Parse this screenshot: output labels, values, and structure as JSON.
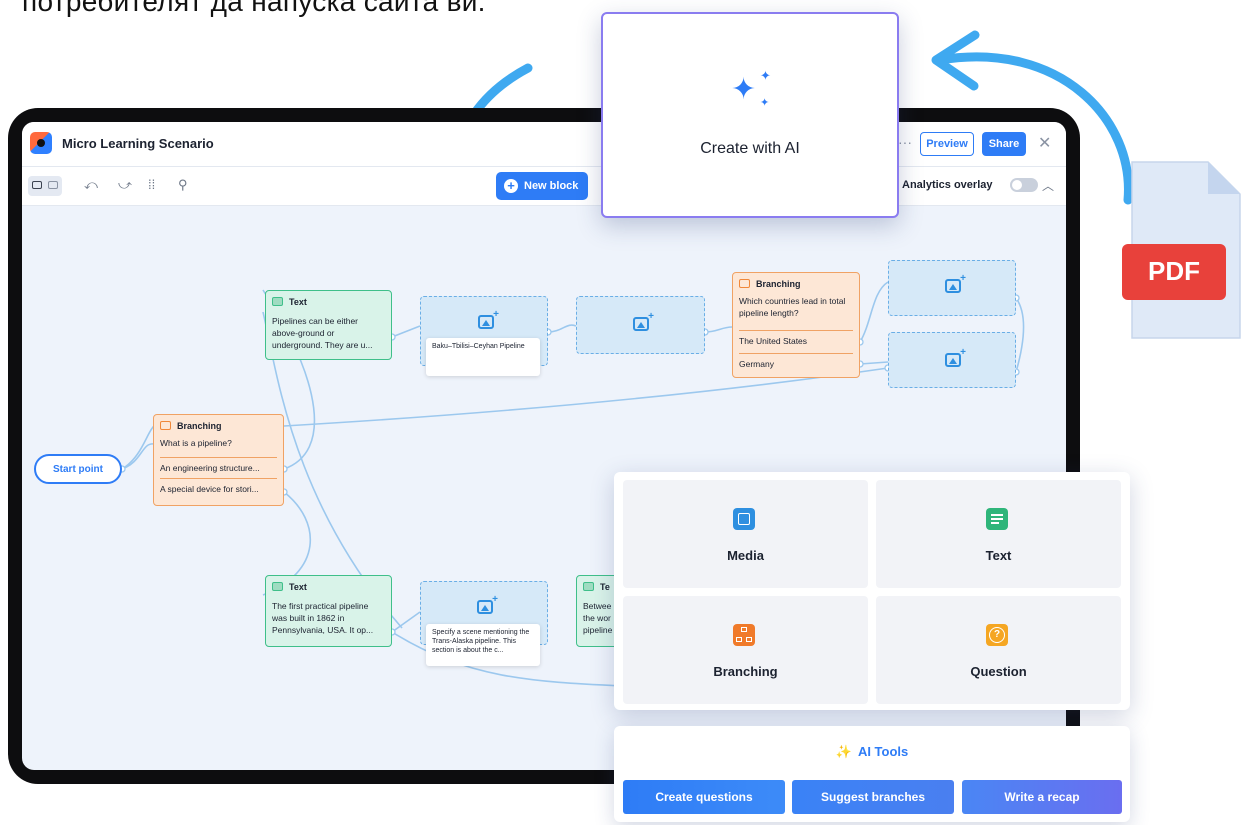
{
  "headline_text": "потребителят да напуска сайта ви.",
  "app": {
    "title": "Micro Learning Scenario",
    "preview_label": "Preview",
    "share_label": "Share",
    "close_glyph": "✕",
    "more_glyph": "···"
  },
  "toolbar": {
    "new_block_label": "New block",
    "analytics_label": "Analytics overlay",
    "analytics_enabled": false
  },
  "canvas": {
    "start_label": "Start point",
    "branching_main": {
      "type_label": "Branching",
      "question": "What is a pipeline?",
      "options": [
        "An engineering structure...",
        "A special device for stori..."
      ]
    },
    "text_top": {
      "type_label": "Text",
      "body": "Pipelines can be either above-ground or underground. They are u..."
    },
    "media_top_caption": "Baku–Tbilisi–Ceyhan Pipeline",
    "branching_right": {
      "type_label": "Branching",
      "question": "Which countries lead in total pipeline length?",
      "options": [
        "The United States",
        "Germany"
      ]
    },
    "text_bottom": {
      "type_label": "Text",
      "body": "The first practical pipeline was built in 1862 in Pennsylvania, USA. It op..."
    },
    "media_bottom_caption": "Specify a scene mentioning the Trans-Alaska pipeline. This section is about the c...",
    "text_partial": {
      "type_label": "Te",
      "body": "Betwee the wor pipeline"
    }
  },
  "create_ai": {
    "label": "Create with AI"
  },
  "pdf": {
    "label": "PDF"
  },
  "blocks": [
    {
      "label": "Media",
      "color": "#2e8fe0",
      "icon": "image-icon"
    },
    {
      "label": "Text",
      "color": "#2fb57a",
      "icon": "text-block-icon"
    },
    {
      "label": "Branching",
      "color": "#f07a2a",
      "icon": "branching-icon"
    },
    {
      "label": "Question",
      "color": "#f5a623",
      "icon": "question-icon"
    }
  ],
  "ai_tools": {
    "title": "AI Tools",
    "buttons": [
      "Create questions",
      "Suggest branches",
      "Write a recap"
    ]
  },
  "colors": {
    "primary": "#2e7cf6",
    "accent_purple": "#8a7cf0",
    "pdf_red": "#e8413b"
  }
}
